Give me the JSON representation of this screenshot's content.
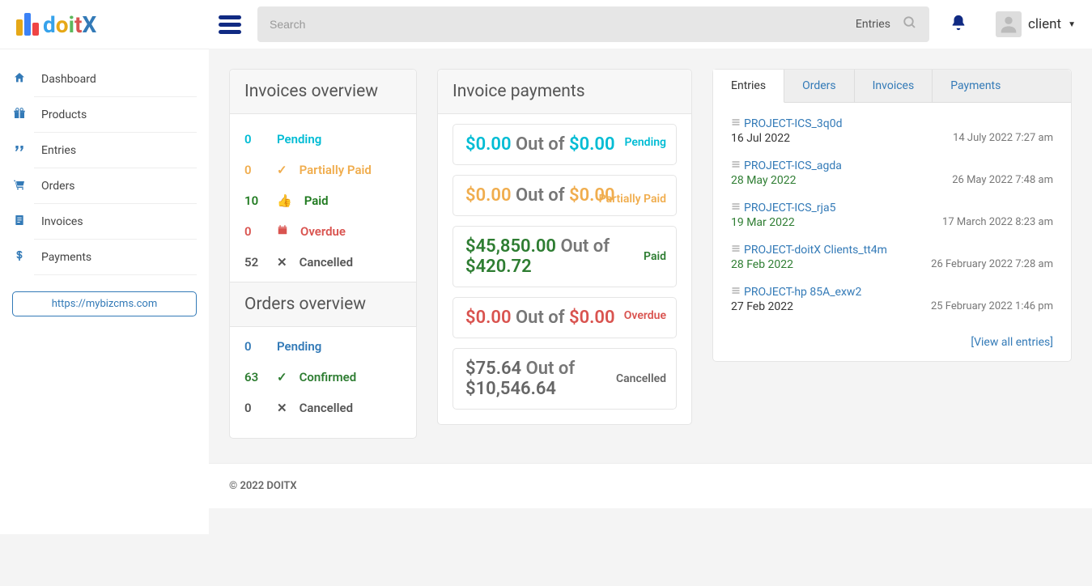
{
  "header": {
    "logo_text": "doitX",
    "search_placeholder": "Search",
    "search_select": "Entries",
    "user_name": "client"
  },
  "sidebar": {
    "items": [
      {
        "label": "Dashboard"
      },
      {
        "label": "Products"
      },
      {
        "label": "Entries"
      },
      {
        "label": "Orders"
      },
      {
        "label": "Invoices"
      },
      {
        "label": "Payments"
      }
    ],
    "site_url": "https://mybizcms.com"
  },
  "invoices_overview": {
    "title": "Invoices overview",
    "rows": [
      {
        "count": "0",
        "label": "Pending"
      },
      {
        "count": "0",
        "label": "Partially Paid"
      },
      {
        "count": "10",
        "label": "Paid"
      },
      {
        "count": "0",
        "label": "Overdue"
      },
      {
        "count": "52",
        "label": "Cancelled"
      }
    ]
  },
  "orders_overview": {
    "title": "Orders overview",
    "rows": [
      {
        "count": "0",
        "label": "Pending"
      },
      {
        "count": "63",
        "label": "Confirmed"
      },
      {
        "count": "0",
        "label": "Cancelled"
      }
    ]
  },
  "payments": {
    "title": "Invoice payments",
    "outof": "Out of",
    "cards": [
      {
        "amount": "$0.00",
        "total": "$0.00",
        "status": "Pending"
      },
      {
        "amount": "$0.00",
        "total": "$0.00",
        "status": "Partially Paid"
      },
      {
        "amount": "$45,850.00",
        "total": "$420.72",
        "status": "Paid"
      },
      {
        "amount": "$0.00",
        "total": "$0.00",
        "status": "Overdue"
      },
      {
        "amount": "$75.64",
        "total": "$10,546.64",
        "status": "Cancelled"
      }
    ]
  },
  "tabs": {
    "items": [
      "Entries",
      "Orders",
      "Invoices",
      "Payments"
    ]
  },
  "entries": [
    {
      "name": "PROJECT-ICS_3q0d",
      "date": "16 Jul 2022",
      "date_green": false,
      "time": "14 July 2022 7:27 am"
    },
    {
      "name": "PROJECT-ICS_agda",
      "date": "28 May 2022",
      "date_green": true,
      "time": "26 May 2022 7:48 am"
    },
    {
      "name": "PROJECT-ICS_rja5",
      "date": "19 Mar 2022",
      "date_green": true,
      "time": "17 March 2022 8:23 am"
    },
    {
      "name": "PROJECT-doitX Clients_tt4m",
      "date": "28 Feb 2022",
      "date_green": true,
      "time": "26 February 2022 7:28 am"
    },
    {
      "name": "PROJECT-hp 85A_exw2",
      "date": "27 Feb 2022",
      "date_green": false,
      "time": "25 February 2022 1:46 pm"
    }
  ],
  "view_all": "[View all entries]",
  "footer": "© 2022 DOITX"
}
